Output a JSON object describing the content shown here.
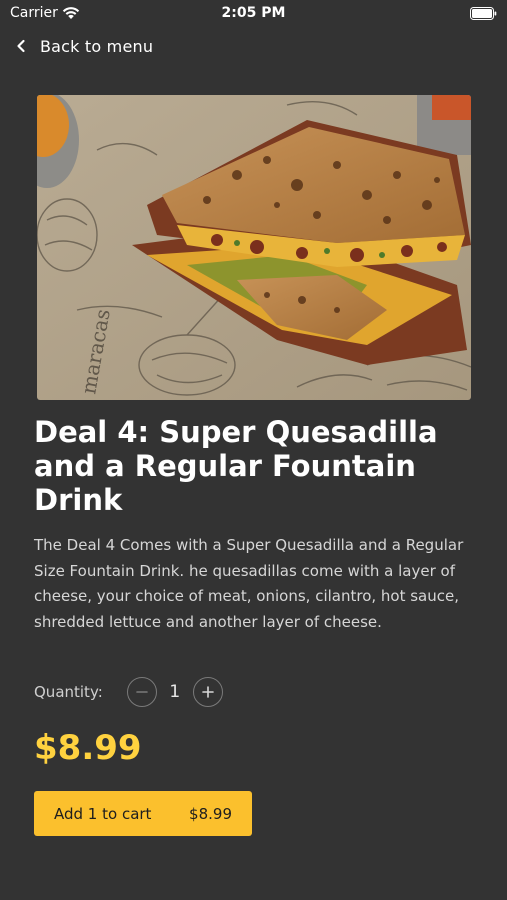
{
  "status_bar": {
    "carrier": "Carrier",
    "time": "2:05 PM",
    "icons": [
      "wifi-icon",
      "battery-icon"
    ]
  },
  "nav": {
    "back_label": "Back to menu",
    "back_icon": "chevron-left-icon"
  },
  "item": {
    "image_alt": "quesadilla-photo",
    "title": "Deal 4: Super Quesadilla and a Regular Fountain Drink",
    "description": "The Deal 4 Comes with a Super Quesadilla and a Regular Size Fountain Drink. he quesadillas come with a layer of cheese, your choice of meat, onions, cilantro, hot sauce, shredded lettuce and another layer of cheese.",
    "price": "$8.99"
  },
  "quantity": {
    "label": "Quantity:",
    "value": "1",
    "decrement_icon": "minus-icon",
    "increment_icon": "plus-icon"
  },
  "cart_button": {
    "label": "Add 1 to cart",
    "price": "$8.99"
  },
  "colors": {
    "background": "#333333",
    "accent": "#fbc02d",
    "price_text": "#ffd23f",
    "text": "#ffffff"
  }
}
